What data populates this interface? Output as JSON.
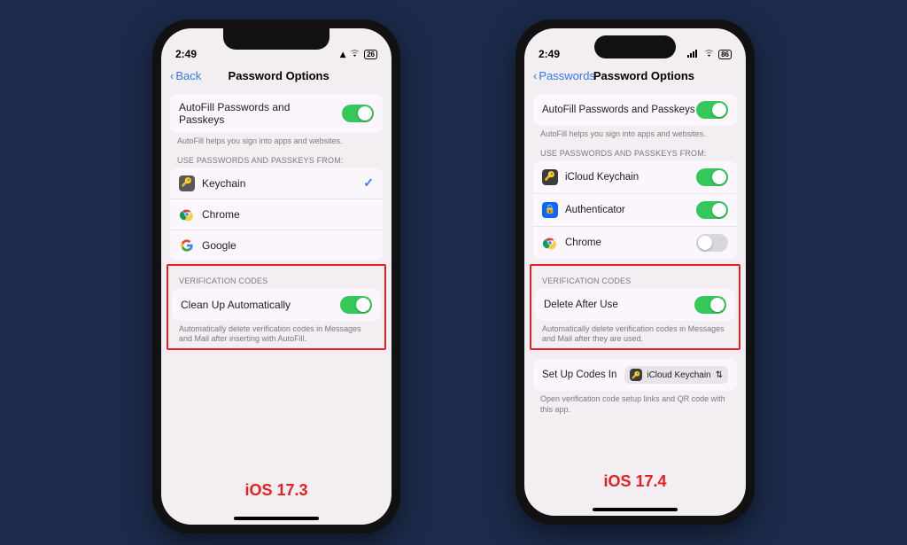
{
  "left": {
    "status": {
      "time": "2:49",
      "battery": "26"
    },
    "nav": {
      "back": "Back",
      "title": "Password Options"
    },
    "autofill": {
      "label": "AutoFill Passwords and Passkeys",
      "footer": "AutoFill helps you sign into apps and websites."
    },
    "sources": {
      "header": "USE PASSWORDS AND PASSKEYS FROM:",
      "items": [
        {
          "label": "Keychain",
          "checked": true
        },
        {
          "label": "Chrome",
          "checked": false
        },
        {
          "label": "Google",
          "checked": false
        }
      ]
    },
    "verification": {
      "header": "VERIFICATION CODES",
      "label": "Clean Up Automatically",
      "footer": "Automatically delete verification codes in Messages and Mail after inserting with AutoFill."
    },
    "version": "iOS 17.3"
  },
  "right": {
    "status": {
      "time": "2:49",
      "battery": "86"
    },
    "nav": {
      "back": "Passwords",
      "title": "Password Options"
    },
    "autofill": {
      "label": "AutoFill Passwords and Passkeys",
      "footer": "AutoFill helps you sign into apps and websites."
    },
    "sources": {
      "header": "USE PASSWORDS AND PASSKEYS FROM:",
      "items": [
        {
          "label": "iCloud Keychain",
          "on": true
        },
        {
          "label": "Authenticator",
          "on": true
        },
        {
          "label": "Chrome",
          "on": false
        }
      ]
    },
    "verification": {
      "header": "VERIFICATION CODES",
      "label": "Delete After Use",
      "footer": "Automatically delete verification codes in Messages and Mail after they are used."
    },
    "setup": {
      "label": "Set Up Codes In",
      "chip": "iCloud Keychain",
      "footer": "Open verification code setup links and QR code with this app."
    },
    "version": "iOS 17.4"
  }
}
